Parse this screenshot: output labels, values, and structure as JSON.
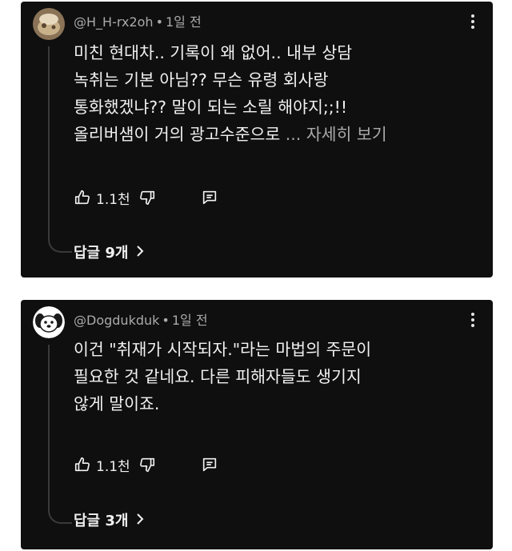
{
  "comments": [
    {
      "author": "@H_H-rx2oh",
      "separator": "•",
      "time": "1일 전",
      "lines": [
        "미친 현대차.. 기록이 왜 없어.. 내부 상담",
        "녹취는 기본 아님?? 무슨 유령 회사랑",
        "통화했겠냐?? 말이 되는 소릴 해야지;;!!",
        "올리버샘이 거의 광고수준으로"
      ],
      "more": "... 자세히 보기",
      "likes": "1.1천",
      "replies": "답글 9개",
      "avatar_icon": "user-photo-avatar",
      "menu_icon": "kebab-menu-icon"
    },
    {
      "author": "@Dogdukduk",
      "separator": "•",
      "time": "1일 전",
      "lines": [
        "이건 \"취재가 시작되자.\"라는 마법의 주문이",
        "필요한 것 같네요. 다른 피해자들도 생기지",
        "않게 말이죠."
      ],
      "likes": "1.1천",
      "replies": "답글 3개",
      "avatar_icon": "dog-avatar",
      "menu_icon": "kebab-menu-icon"
    }
  ],
  "colors": {
    "card_bg": "#0f0f0f",
    "text": "#f1f1f1",
    "meta_text": "#aaaaaa",
    "page_bg": "#ffffff"
  }
}
